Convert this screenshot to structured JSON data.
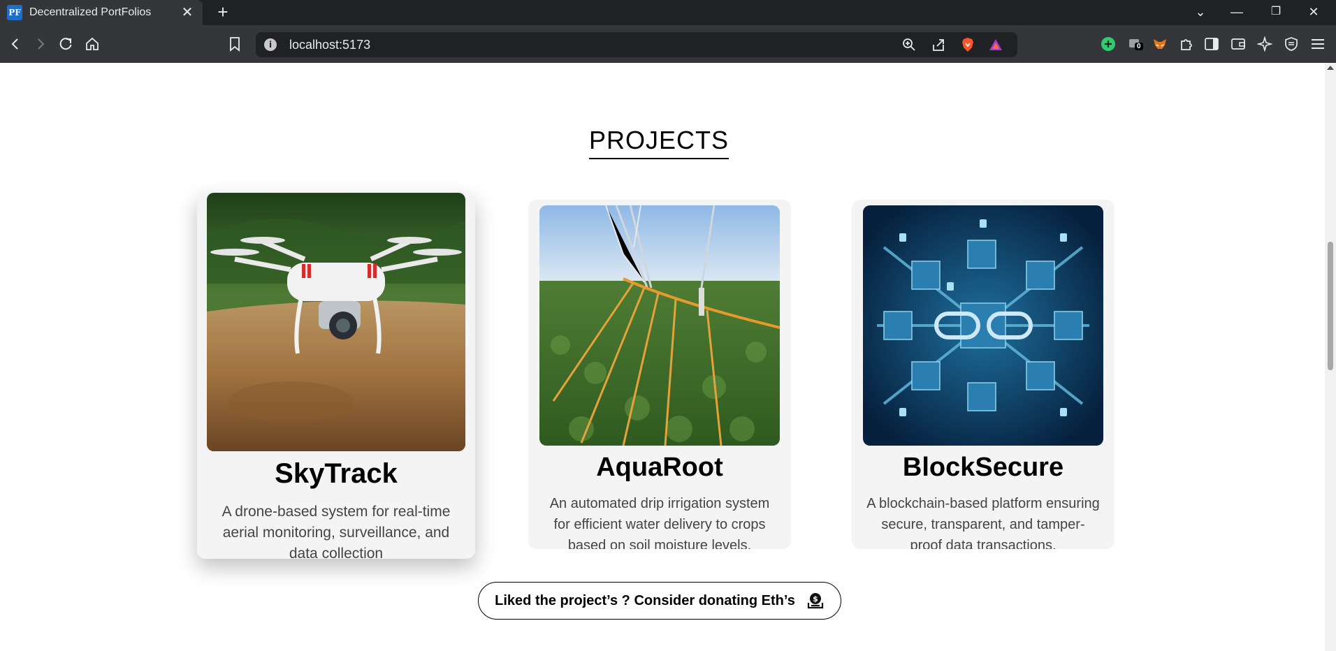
{
  "browser": {
    "tab_title": "Decentralized PortFolios",
    "favicon_text": "PF",
    "url": "localhost:5173",
    "extension_badge": "0"
  },
  "section": {
    "title": "PROJECTS"
  },
  "projects": [
    {
      "title": "SkyTrack",
      "description": "A drone-based system for real-time aerial monitoring, surveillance, and data collection"
    },
    {
      "title": "AquaRoot",
      "description": "An automated drip irrigation system for efficient water delivery to crops based on soil moisture levels."
    },
    {
      "title": "BlockSecure",
      "description": "A blockchain-based platform ensuring secure, transparent, and tamper-proof data transactions."
    }
  ],
  "donate": {
    "label": "Liked the project’s ? Consider donating Eth’s"
  }
}
